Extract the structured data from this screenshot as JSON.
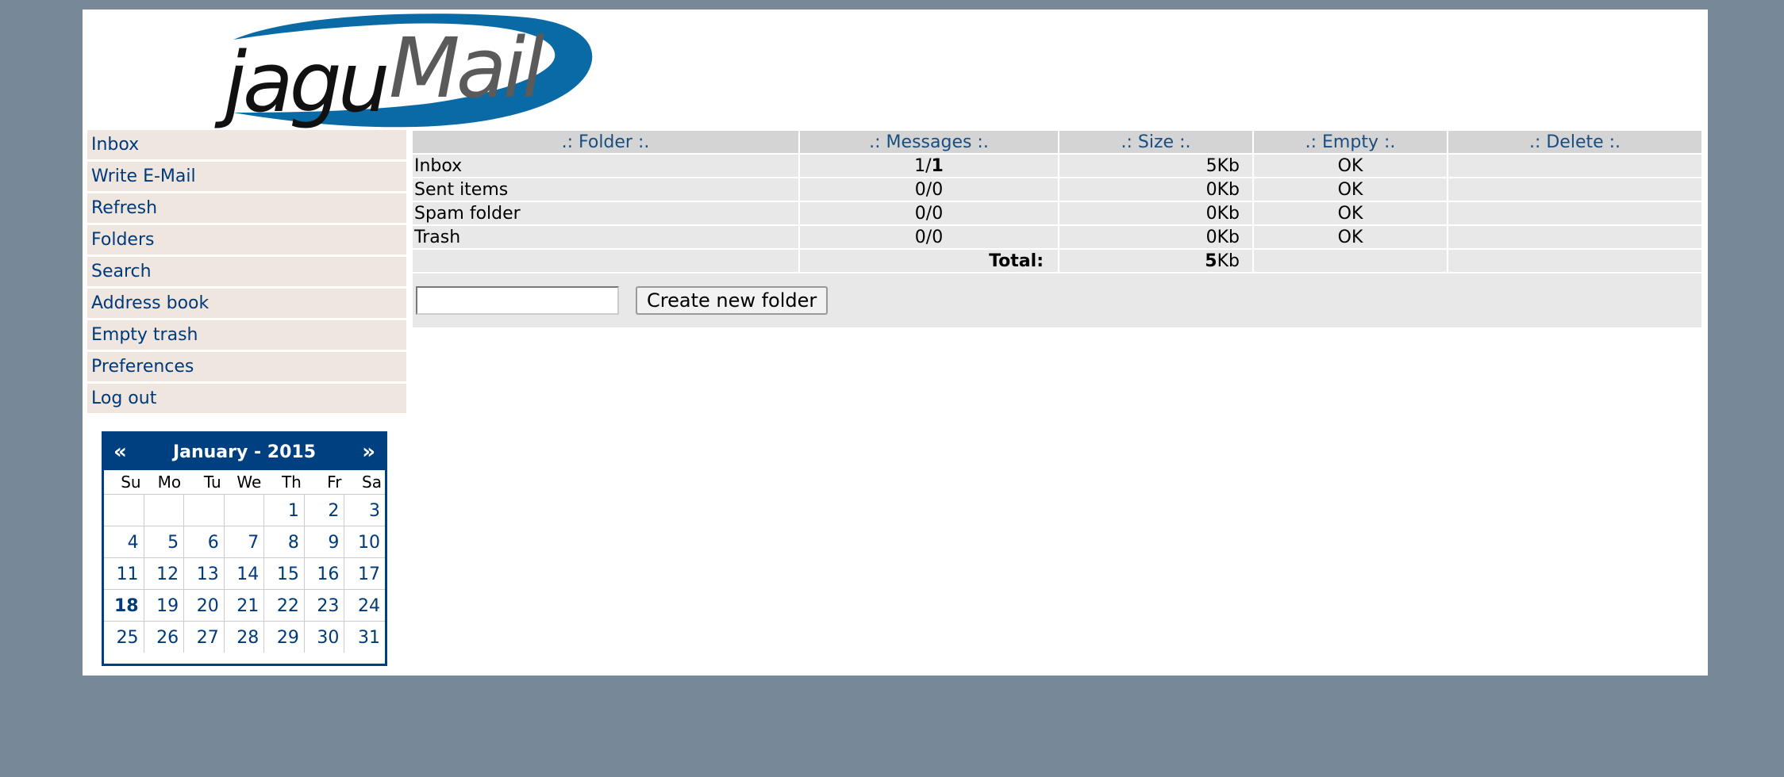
{
  "logo": {
    "brand_text": "jaguMail"
  },
  "sidebar": {
    "items": [
      {
        "label": "Inbox"
      },
      {
        "label": "Write E-Mail"
      },
      {
        "label": "Refresh"
      },
      {
        "label": "Folders"
      },
      {
        "label": "Search"
      },
      {
        "label": "Address book"
      },
      {
        "label": "Empty trash"
      },
      {
        "label": "Preferences"
      },
      {
        "label": "Log out"
      }
    ]
  },
  "calendar": {
    "prev": "«",
    "next": "»",
    "title": "January - 2015",
    "weekdays": [
      "Su",
      "Mo",
      "Tu",
      "We",
      "Th",
      "Fr",
      "Sa"
    ],
    "weeks": [
      [
        "",
        "",
        "",
        "",
        "1",
        "2",
        "3"
      ],
      [
        "4",
        "5",
        "6",
        "7",
        "8",
        "9",
        "10"
      ],
      [
        "11",
        "12",
        "13",
        "14",
        "15",
        "16",
        "17"
      ],
      [
        "18",
        "19",
        "20",
        "21",
        "22",
        "23",
        "24"
      ],
      [
        "25",
        "26",
        "27",
        "28",
        "29",
        "30",
        "31"
      ]
    ],
    "today": "18"
  },
  "folders": {
    "headers": {
      "folder": ".: Folder :.",
      "messages": ".: Messages :.",
      "size": ".: Size :.",
      "empty": ".: Empty :.",
      "delete": ".: Delete :."
    },
    "rows": [
      {
        "name": "Inbox",
        "msg_unread": "1",
        "msg_total": "1",
        "size_value": "5",
        "size_unit": "Kb",
        "empty": "OK",
        "delete": ""
      },
      {
        "name": "Sent items",
        "msg_unread": "0",
        "msg_total": "0",
        "size_value": "0",
        "size_unit": "Kb",
        "empty": "OK",
        "delete": ""
      },
      {
        "name": "Spam folder",
        "msg_unread": "0",
        "msg_total": "0",
        "size_value": "0",
        "size_unit": "Kb",
        "empty": "OK",
        "delete": ""
      },
      {
        "name": "Trash",
        "msg_unread": "0",
        "msg_total": "0",
        "size_value": "0",
        "size_unit": "Kb",
        "empty": "OK",
        "delete": ""
      }
    ],
    "total_label": "Total:",
    "total_value": "5",
    "total_unit": "Kb",
    "new_folder_value": "",
    "create_button": "Create new folder"
  }
}
